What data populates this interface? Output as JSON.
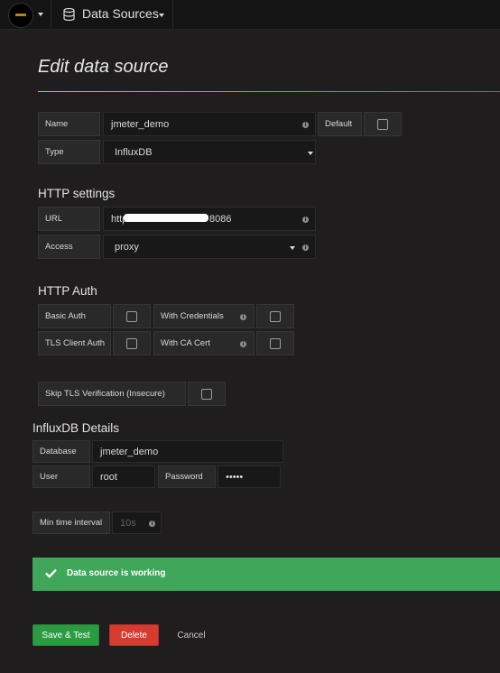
{
  "header": {
    "title": "Data Sources",
    "logo_icon": "grafana-logo-icon",
    "db_icon": "database-icon"
  },
  "page": {
    "title": "Edit data source"
  },
  "general": {
    "name_label": "Name",
    "name_value": "jmeter_demo",
    "default_label": "Default",
    "type_label": "Type",
    "type_value": "InfluxDB"
  },
  "http_settings": {
    "title": "HTTP settings",
    "url_label": "URL",
    "url_prefix": "http://",
    "url_port": "8086",
    "access_label": "Access",
    "access_value": "proxy"
  },
  "http_auth": {
    "title": "HTTP Auth",
    "basic_auth_label": "Basic Auth",
    "with_credentials_label": "With Credentials",
    "tls_client_auth_label": "TLS Client Auth",
    "with_ca_cert_label": "With CA Cert",
    "skip_tls_label": "Skip TLS Verification (Insecure)"
  },
  "influxdb": {
    "title": "InfluxDB Details",
    "database_label": "Database",
    "database_value": "jmeter_demo",
    "user_label": "User",
    "user_value": "root",
    "password_label": "Password",
    "password_value": "•••••",
    "min_interval_label": "Min time interval",
    "min_interval_placeholder": "10s"
  },
  "status": {
    "message": "Data source is working",
    "color": "#3fa65a"
  },
  "actions": {
    "save_test": "Save & Test",
    "delete": "Delete",
    "cancel": "Cancel",
    "save_color": "#2b9b42",
    "delete_color": "#d63b30"
  }
}
